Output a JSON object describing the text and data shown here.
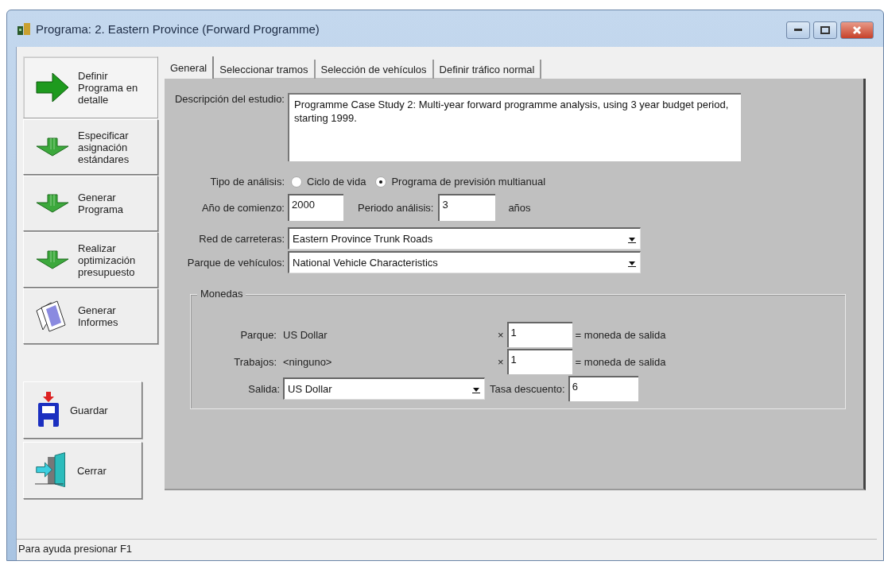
{
  "window": {
    "title": "Programa: 2. Eastern Province (Forward Programme)"
  },
  "sidebar": {
    "items": [
      {
        "label": "Definir Programa en detalle",
        "kind": "forward",
        "selected": true
      },
      {
        "label": "Especificar asignación estándares",
        "kind": "down",
        "selected": false
      },
      {
        "label": "Generar Programa",
        "kind": "down",
        "selected": false
      },
      {
        "label": "Realizar optimización presupuesto",
        "kind": "down",
        "selected": false
      },
      {
        "label": "Generar Informes",
        "kind": "report",
        "selected": false
      }
    ],
    "actions": [
      {
        "label": "Guardar",
        "kind": "save"
      },
      {
        "label": "Cerrar",
        "kind": "exit"
      }
    ]
  },
  "tabs": [
    {
      "label": "General",
      "selected": true
    },
    {
      "label": "Seleccionar tramos",
      "selected": false
    },
    {
      "label": "Selección de vehículos",
      "selected": false
    },
    {
      "label": "Definir tráfico normal",
      "selected": false
    }
  ],
  "form": {
    "description": {
      "label": "Descripción del estudio:",
      "value": "Programme Case Study 2: Multi-year forward programme analysis, using 3 year budget period, starting 1999."
    },
    "analysis_type": {
      "label": "Tipo de análisis:",
      "options": [
        {
          "label": "Ciclo de vida",
          "selected": false
        },
        {
          "label": "Programa de previsión multianual",
          "selected": true
        }
      ]
    },
    "start_year": {
      "label": "Año de comienzo:",
      "value": "2000"
    },
    "period": {
      "label": "Periodo análisis:",
      "value": "3",
      "unit": "años"
    },
    "road_network": {
      "label": "Red de carreteras:",
      "value": "Eastern Province Trunk Roads"
    },
    "fleet": {
      "label": "Parque de vehículos:",
      "value": "National Vehicle Characteristics"
    },
    "currencies": {
      "title": "Monedas",
      "rows": [
        {
          "label": "Parque:",
          "currency": "US Dollar",
          "times": "×",
          "factor": "1",
          "suffix": "= moneda de salida"
        },
        {
          "label": "Trabajos:",
          "currency": "<ninguno>",
          "times": "×",
          "factor": "1",
          "suffix": "= moneda de salida"
        }
      ],
      "output": {
        "label": "Salida:",
        "value": "US Dollar"
      },
      "discount": {
        "label": "Tasa descuento:",
        "value": "6"
      }
    }
  },
  "status_bar": {
    "text": "Para ayuda presionar F1"
  }
}
